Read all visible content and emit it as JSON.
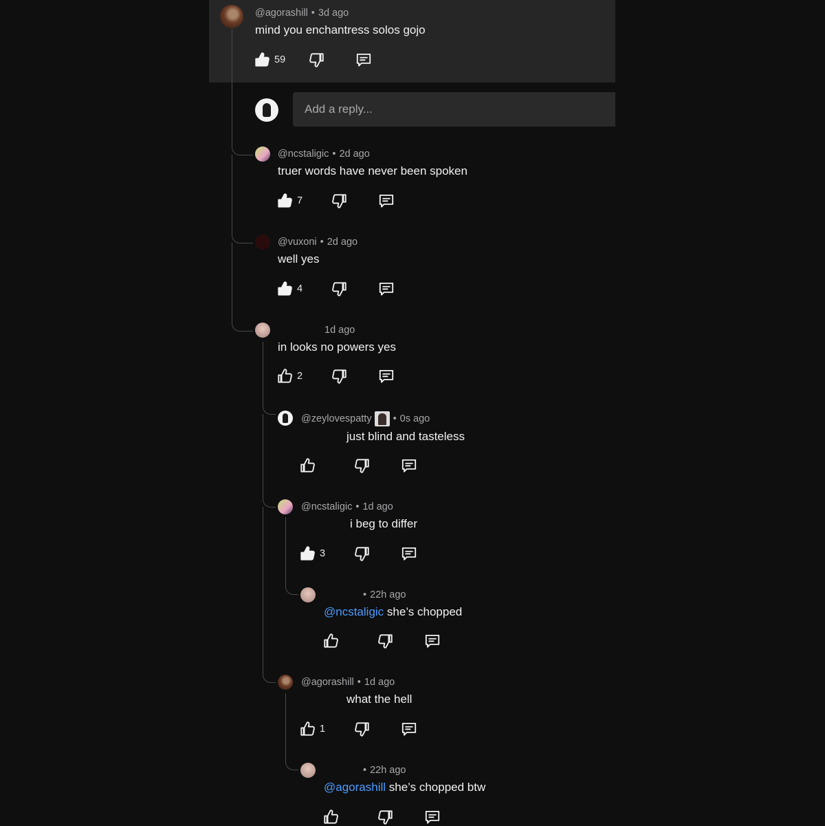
{
  "colors": {
    "background": "#0f0f10",
    "highlight": "#262627",
    "mention": "#4b9bff",
    "thread_line": "#4a4a4c"
  },
  "reply_input": {
    "placeholder": "Add a reply..."
  },
  "comments": [
    {
      "author": "@agorashill",
      "time": "3d ago",
      "text": "mind you enchantress solos gojo",
      "likes": "59",
      "liked": true
    },
    {
      "author": "@ncstaligic",
      "time": "2d ago",
      "text": "truer words have never been spoken",
      "likes": "7",
      "liked": true
    },
    {
      "author": "@vuxoni",
      "time": "2d ago",
      "text": "well yes",
      "likes": "4",
      "liked": true
    },
    {
      "author": "",
      "time": "1d ago",
      "text": "in looks no powers yes",
      "likes": "2",
      "liked": false
    },
    {
      "author": "@zeylovespatty",
      "time": "0s ago",
      "text": "just blind and tasteless",
      "likes": "",
      "liked": false
    },
    {
      "author": "@ncstaligic",
      "time": "1d ago",
      "text": "i beg to differ",
      "likes": "3",
      "liked": true
    },
    {
      "author": "",
      "time": "22h ago",
      "mention": "@ncstaligic",
      "text": " she’s chopped",
      "likes": "",
      "liked": false
    },
    {
      "author": "@agorashill",
      "time": "1d ago",
      "text": "what the hell",
      "likes": "1",
      "liked": false
    },
    {
      "author": "",
      "time": "22h ago",
      "mention": "@agorashill",
      "text": " she’s chopped btw",
      "likes": "",
      "liked": false
    }
  ],
  "separator": "•",
  "icons": [
    "thumbs-up-icon",
    "thumbs-up-filled-icon",
    "thumbs-down-icon",
    "reply-comment-icon"
  ]
}
